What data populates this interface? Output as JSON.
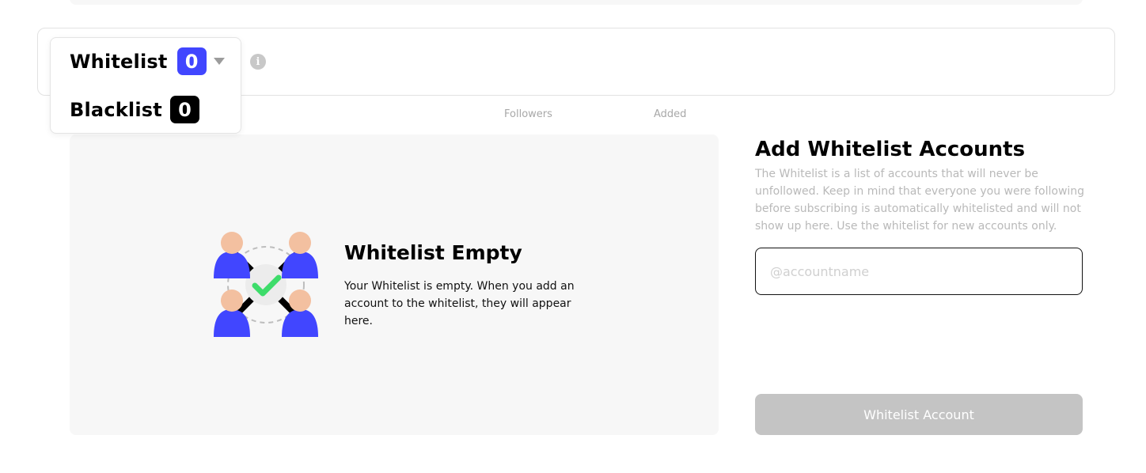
{
  "dropdown": {
    "whitelist_label": "Whitelist",
    "whitelist_count": "0",
    "blacklist_label": "Blacklist",
    "blacklist_count": "0"
  },
  "info_icon_glyph": "i",
  "table": {
    "columns": [
      "Followers",
      "Added"
    ]
  },
  "empty_state": {
    "title": "Whitelist Empty",
    "text": "Your Whitelist is empty. When you add an account to the whitelist, they will appear here."
  },
  "add_panel": {
    "title": "Add Whitelist Accounts",
    "description": "The Whitelist is a list of accounts that will never be unfollowed. Keep in mind that everyone you were following before subscribing is automatically whitelisted and will not show up here. Use the whitelist for new accounts only.",
    "input_placeholder": "@accountname",
    "input_value": "",
    "button_label": "Whitelist Account"
  },
  "colors": {
    "accent_blue": "#4146ff",
    "check_green": "#3ddc6a",
    "skin": "#f3c0a0",
    "button_disabled": "#c4c4c4"
  }
}
